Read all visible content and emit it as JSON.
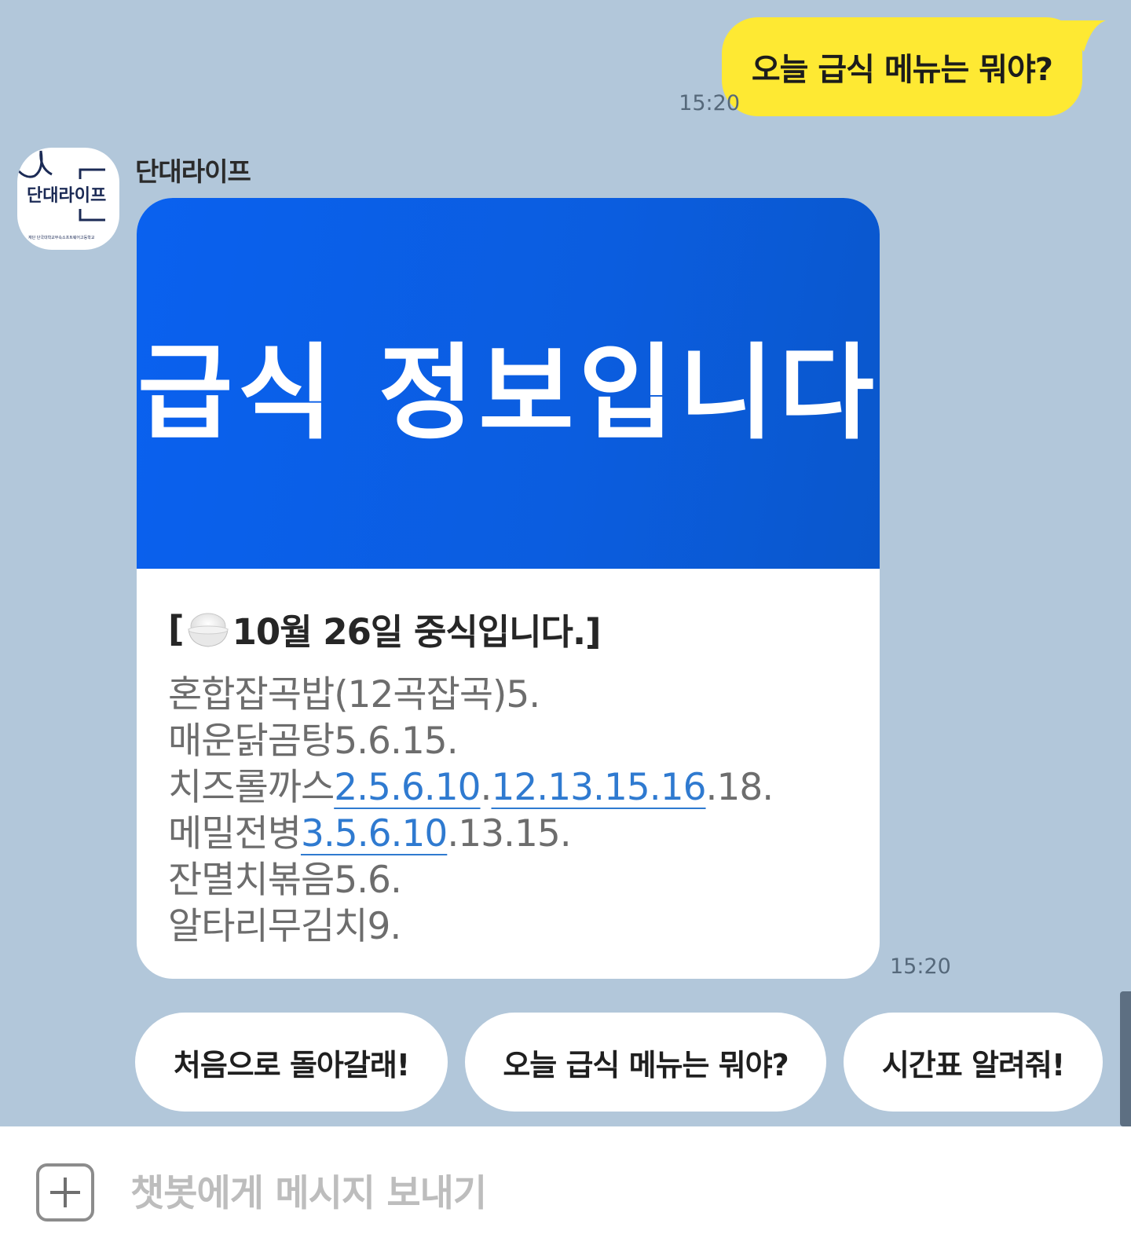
{
  "outgoing": {
    "text": "오늘 급식 메뉴는 뭐야?",
    "time": "15:20"
  },
  "bot": {
    "name": "단대라이프",
    "avatar": {
      "logo_text": "단대라이프",
      "sub_text": "재단 단국대학교부속소프트웨어고등학교"
    }
  },
  "card": {
    "banner_title": "급식 정보입니다",
    "heading_prefix": "[",
    "heading_text": "10월 26일 중식입니다.]",
    "menu": [
      {
        "name": "혼합잡곡밥(12곡잡곡)5."
      },
      {
        "name": "매운닭곰탕5.6.15."
      },
      {
        "name": "치즈롤까스",
        "link1": "2.5.6.10",
        "sep": ".",
        "link2": "12.13.15.16",
        "tail": ".18."
      },
      {
        "name": "메밀전병",
        "link1": "3.5.6.10",
        "tail": ".13.15."
      },
      {
        "name": "잔멸치볶음5.6."
      },
      {
        "name": "알타리무김치9."
      }
    ],
    "time": "15:20"
  },
  "quick_replies": [
    "처음으로 돌아갈래!",
    "오늘 급식 메뉴는 뭐야?",
    "시간표 알려줘!"
  ],
  "input": {
    "placeholder": "챗봇에게 메시지 보내기"
  },
  "colors": {
    "background": "#b2c7da",
    "outgoing_bubble": "#fee933",
    "banner": "#0a61ef",
    "link": "#2f7ad0"
  }
}
